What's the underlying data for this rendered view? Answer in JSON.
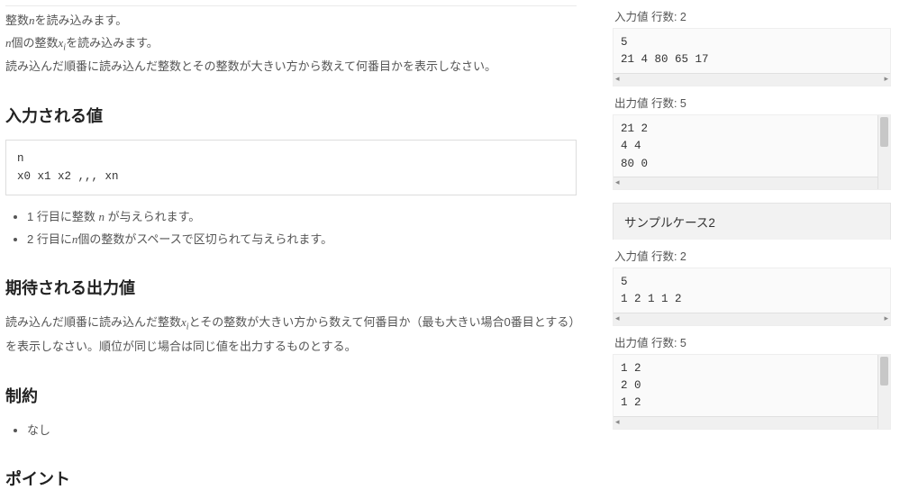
{
  "main": {
    "desc": {
      "l1_pre": "整数",
      "l1_var": "n",
      "l1_post": "を読み込みます。",
      "l2_var": "n",
      "l2_mid": "個の整数",
      "l2_xi_x": "x",
      "l2_xi_i": "i",
      "l2_post": "を読み込みます。",
      "l3": "読み込んだ順番に読み込んだ整数とその整数が大きい方から数えて何番目かを表示しなさい。"
    },
    "h_input": "入力される値",
    "input_block": "n\nx0 x1 x2 ,,, xn",
    "input_notes": {
      "n1_pre": "1 行目に整数 ",
      "n1_var": "n",
      "n1_post": " が与えられます。",
      "n2_pre": "2 行目に",
      "n2_var": "n",
      "n2_post": "個の整数がスペースで区切られて与えられます。"
    },
    "h_expected": "期待される出力値",
    "expected_p_pre": "読み込んだ順番に読み込んだ整数",
    "expected_xi_x": "x",
    "expected_xi_i": "i",
    "expected_p_post": "とその整数が大きい方から数えて何番目か（最も大きい場合0番目とする）を表示しなさい。順位が同じ場合は同じ値を出力するものとする。",
    "h_constraints": "制約",
    "constraint_none": "なし",
    "h_points": "ポイント"
  },
  "side": {
    "case1": {
      "in_label": "入力値 行数: 2",
      "in_text": "5\n21 4 80 65 17",
      "out_label": "出力値 行数: 5",
      "out_text": "21 2\n4 4\n80 0"
    },
    "case2": {
      "title": "サンプルケース2",
      "in_label": "入力値 行数: 2",
      "in_text": "5\n1 2 1 1 2",
      "out_label": "出力値 行数: 5",
      "out_text": "1 2\n2 0\n1 2"
    }
  }
}
